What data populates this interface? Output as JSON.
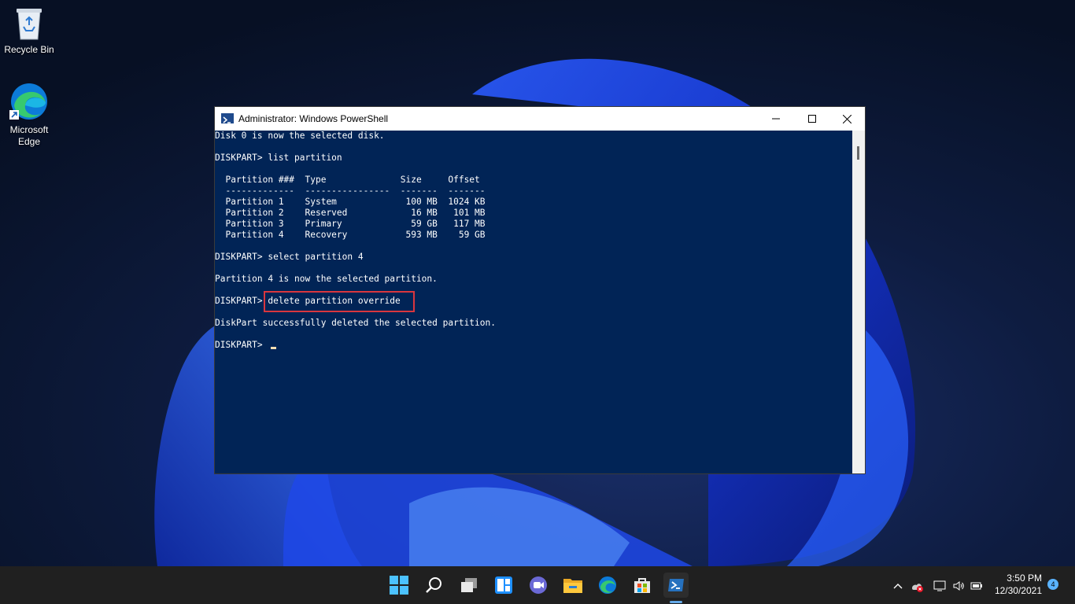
{
  "desktop": {
    "icons": [
      {
        "label": "Recycle Bin"
      },
      {
        "label": "Microsoft Edge"
      }
    ]
  },
  "window": {
    "title": "Administrator: Windows PowerShell",
    "terminal_lines": [
      "Disk 0 is now the selected disk.",
      "",
      "DISKPART> list partition",
      "",
      "  Partition ###  Type              Size     Offset",
      "  -------------  ----------------  -------  -------",
      "  Partition 1    System             100 MB  1024 KB",
      "  Partition 2    Reserved            16 MB   101 MB",
      "  Partition 3    Primary             59 GB   117 MB",
      "  Partition 4    Recovery           593 MB    59 GB",
      "",
      "DISKPART> select partition 4",
      "",
      "Partition 4 is now the selected partition.",
      "",
      "DISKPART> delete partition override",
      "",
      "DiskPart successfully deleted the selected partition.",
      "",
      "DISKPART> "
    ],
    "highlight_color": "#d9363e",
    "background_color": "#012456"
  },
  "taskbar": {
    "items": [
      "start-icon",
      "search-icon",
      "task-view-icon",
      "widgets-icon",
      "chat-icon",
      "file-explorer-icon",
      "edge-icon",
      "store-icon",
      "powershell-icon"
    ],
    "clock": {
      "time": "3:50 PM",
      "date": "12/30/2021"
    },
    "notification_count": "4"
  }
}
